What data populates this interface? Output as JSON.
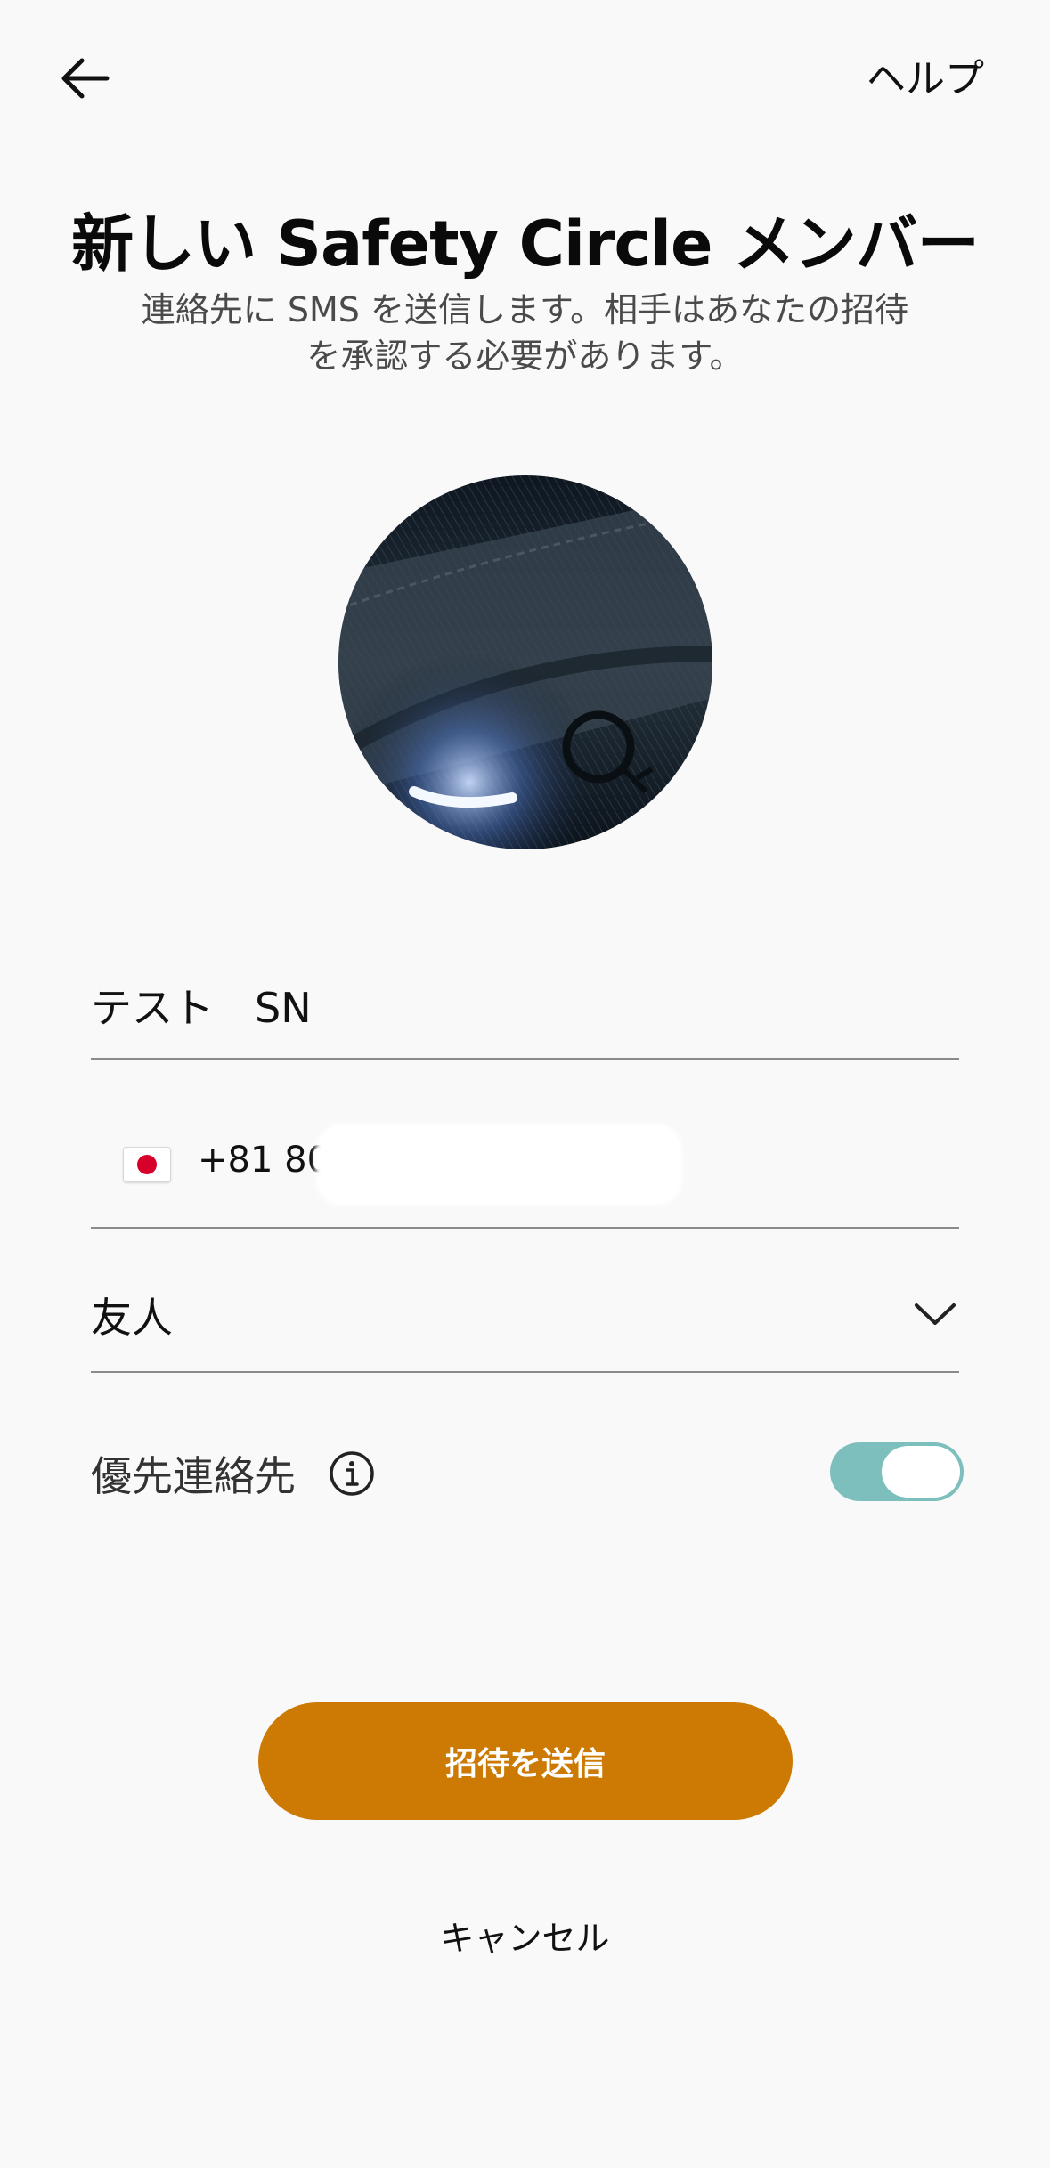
{
  "header": {
    "back_icon": "arrow-left-icon",
    "help_label": "ヘルプ"
  },
  "title": "新しい Safety Circle メンバー",
  "subtitle_line1": "連絡先に SMS を送信します。相手はあなたの招待",
  "subtitle_line2": "を承認する必要があります。",
  "form": {
    "name_value": "テスト　SN",
    "phone_flag": "japan-flag-icon",
    "phone_value": "+81 80-",
    "relationship_value": "友人",
    "relationship_icon": "chevron-down-icon",
    "priority_label": "優先連絡先",
    "priority_info_icon": "info-icon",
    "priority_enabled": true
  },
  "actions": {
    "send_label": "招待を送信",
    "cancel_label": "キャンセル"
  },
  "colors": {
    "accent": "#cc7a03",
    "toggle_on": "#7cbfbd",
    "background": "#f9f9f9"
  }
}
